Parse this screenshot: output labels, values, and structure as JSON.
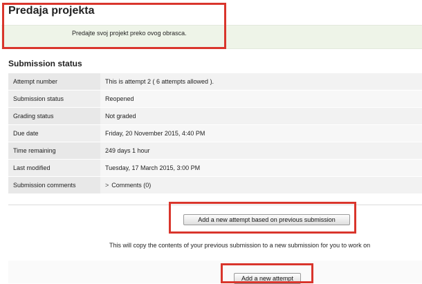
{
  "page": {
    "title": "Predaja projekta",
    "intro": "Predajte svoj projekt preko ovog obrasca."
  },
  "submission": {
    "heading": "Submission status",
    "rows": [
      {
        "label": "Attempt number",
        "value": "This is attempt 2 ( 6 attempts allowed )."
      },
      {
        "label": "Submission status",
        "value": "Reopened"
      },
      {
        "label": "Grading status",
        "value": "Not graded"
      },
      {
        "label": "Due date",
        "value": "Friday, 20 November 2015, 4:40 PM"
      },
      {
        "label": "Time remaining",
        "value": "249 days 1 hour"
      },
      {
        "label": "Last modified",
        "value": "Tuesday, 17 March 2015, 3:00 PM"
      },
      {
        "label": "Submission comments",
        "value": "Comments (0)"
      }
    ]
  },
  "actions": {
    "previous_attempt_label": "Add a new attempt based on previous submission",
    "copy_note": "This will copy the contents of your previous submission to a new submission for you to work on",
    "new_attempt_label": "Add a new attempt"
  },
  "colors": {
    "highlight": "#d9352c",
    "intro_background": "#eef4e8"
  },
  "icons": {
    "comments_toggle": "chevron-right-icon"
  }
}
